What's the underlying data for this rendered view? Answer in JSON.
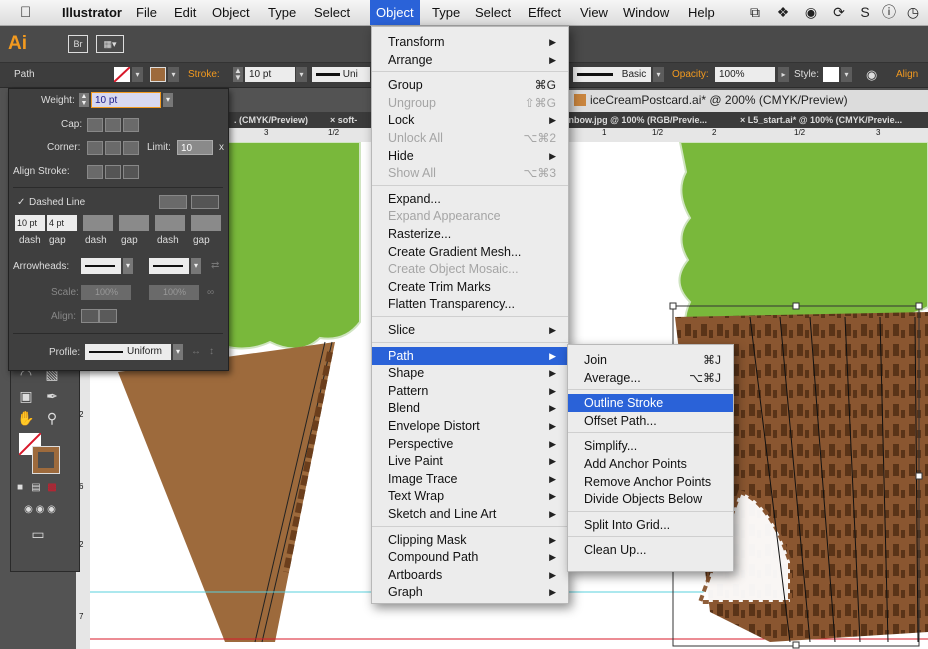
{
  "menubar": {
    "app_name": "Illustrator",
    "items": [
      "File",
      "Edit",
      "Object",
      "Type",
      "Select",
      "Object",
      "Type",
      "Select",
      "Effect",
      "View",
      "Window",
      "Help"
    ],
    "apple_icon": "apple-icon",
    "status_icons": [
      "window-icon",
      "dropbox-icon",
      "creative-cloud-icon",
      "sync-icon",
      "dollar-icon",
      "info-icon",
      "time-machine-icon"
    ]
  },
  "appbar": {
    "logo": "Ai",
    "bridge": "Br"
  },
  "control_bar": {
    "selection": "Path",
    "stroke_label": "Stroke:",
    "stroke_weight": "10 pt",
    "profile_short": "Uni",
    "brush": "Basic",
    "opacity_label": "Opacity:",
    "opacity_value": "100%",
    "style_label": "Style:",
    "align_label": "Align"
  },
  "document": {
    "title": "iceCreamPostcard.ai* @ 200% (CMYK/Preview)",
    "tabs": [
      ". (CMYK/Preview)",
      "× soft-",
      "inbow.jpg @ 100% (RGB/Previe...",
      "× L5_start.ai* @ 100% (CMYK/Previe..."
    ],
    "ruler_h": [
      "3",
      "1/2",
      "1",
      "1/2",
      "2",
      "1/2",
      "3"
    ],
    "ruler_v": [
      "2",
      "6",
      "2",
      "7"
    ]
  },
  "stroke_panel": {
    "weight_label": "Weight:",
    "weight_value": "10 pt",
    "cap_label": "Cap:",
    "corner_label": "Corner:",
    "limit_label": "Limit:",
    "limit_value": "10",
    "limit_unit": "x",
    "align_stroke_label": "Align Stroke:",
    "dashed_line_label": "Dashed Line",
    "dashed_line_checked": true,
    "dash_values": [
      "10 pt",
      "4 pt",
      "",
      "",
      "",
      ""
    ],
    "dash_labels": [
      "dash",
      "gap",
      "dash",
      "gap",
      "dash",
      "gap"
    ],
    "arrowheads_label": "Arrowheads:",
    "scale_label": "Scale:",
    "scale_values": [
      "100%",
      "100%"
    ],
    "align_label": "Align:",
    "profile_label": "Profile:",
    "profile_value": "Uniform"
  },
  "object_menu": {
    "items": [
      {
        "label": "Transform",
        "submenu": true
      },
      {
        "label": "Arrange",
        "submenu": true
      },
      {
        "label": "Group",
        "shortcut": "⌘G"
      },
      {
        "label": "Ungroup",
        "shortcut": "⇧⌘G",
        "disabled": true
      },
      {
        "label": "Lock",
        "submenu": true
      },
      {
        "label": "Unlock All",
        "shortcut": "⌥⌘2",
        "disabled": true
      },
      {
        "label": "Hide",
        "submenu": true
      },
      {
        "label": "Show All",
        "shortcut": "⌥⌘3",
        "disabled": true
      },
      {
        "label": "Expand..."
      },
      {
        "label": "Expand Appearance",
        "disabled": true
      },
      {
        "label": "Rasterize..."
      },
      {
        "label": "Create Gradient Mesh..."
      },
      {
        "label": "Create Object Mosaic...",
        "disabled": true
      },
      {
        "label": "Create Trim Marks"
      },
      {
        "label": "Flatten Transparency..."
      },
      {
        "label": "Slice",
        "submenu": true
      },
      {
        "label": "Path",
        "submenu": true,
        "highlighted": true
      },
      {
        "label": "Shape",
        "submenu": true
      },
      {
        "label": "Pattern",
        "submenu": true
      },
      {
        "label": "Blend",
        "submenu": true
      },
      {
        "label": "Envelope Distort",
        "submenu": true
      },
      {
        "label": "Perspective",
        "submenu": true
      },
      {
        "label": "Live Paint",
        "submenu": true
      },
      {
        "label": "Image Trace",
        "submenu": true
      },
      {
        "label": "Text Wrap",
        "submenu": true
      },
      {
        "label": "Sketch and Line Art",
        "submenu": true
      },
      {
        "label": "Clipping Mask",
        "submenu": true
      },
      {
        "label": "Compound Path",
        "submenu": true
      },
      {
        "label": "Artboards",
        "submenu": true
      },
      {
        "label": "Graph",
        "submenu": true
      }
    ]
  },
  "path_submenu": {
    "items": [
      {
        "label": "Join",
        "shortcut": "⌘J"
      },
      {
        "label": "Average...",
        "shortcut": "⌥⌘J"
      },
      {
        "label": "Outline Stroke",
        "highlighted": true
      },
      {
        "label": "Offset Path..."
      },
      {
        "label": "Simplify..."
      },
      {
        "label": "Add Anchor Points"
      },
      {
        "label": "Remove Anchor Points"
      },
      {
        "label": "Divide Objects Below"
      },
      {
        "label": "Split Into Grid..."
      },
      {
        "label": "Clean Up..."
      }
    ]
  },
  "colors": {
    "accent": "#2a62d8",
    "ai_orange": "#f39a1f",
    "tree_green": "#79b83b",
    "cone_brown": "#9d6a3c",
    "waffle_brown": "#7a4a25",
    "annotation_red": "#d8182a"
  }
}
